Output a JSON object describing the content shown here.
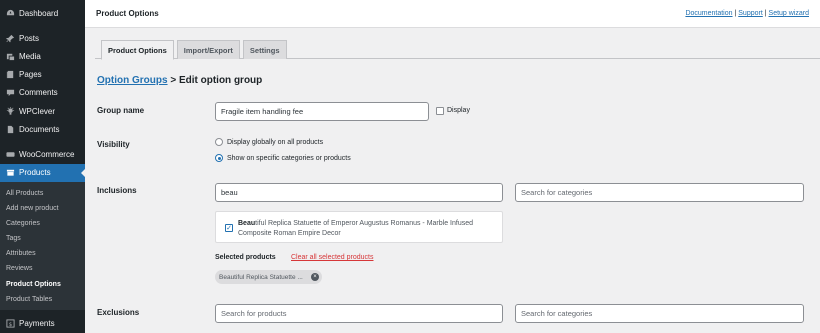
{
  "sidebar": {
    "items": [
      {
        "label": "Dashboard",
        "icon": "dashboard-icon"
      },
      {
        "label": "Posts",
        "icon": "pin-icon"
      },
      {
        "label": "Media",
        "icon": "media-icon"
      },
      {
        "label": "Pages",
        "icon": "pages-icon"
      },
      {
        "label": "Comments",
        "icon": "comment-icon"
      },
      {
        "label": "WPClever",
        "icon": "lightbulb-icon"
      },
      {
        "label": "Documents",
        "icon": "document-icon"
      },
      {
        "label": "WooCommerce",
        "icon": "woo-icon"
      },
      {
        "label": "Products",
        "icon": "archive-icon"
      }
    ],
    "submenu": [
      "All Products",
      "Add new product",
      "Categories",
      "Tags",
      "Attributes",
      "Reviews",
      "Product Options",
      "Product Tables"
    ],
    "payments": {
      "label": "Payments",
      "icon": "dollar-icon"
    }
  },
  "header": {
    "title": "Product Options",
    "links": [
      "Documentation",
      "Support",
      "Setup wizard"
    ],
    "separator": "|"
  },
  "tabs": [
    "Product Options",
    "Import/Export",
    "Settings"
  ],
  "breadcrumb": {
    "link": "Option Groups",
    "separator": ">",
    "current": "Edit option group"
  },
  "group_name": {
    "label": "Group name",
    "value": "Fragile item handling fee",
    "display_label": "Display"
  },
  "visibility": {
    "label": "Visibility",
    "options": [
      "Display globally on all products",
      "Show on specific categories or products"
    ],
    "selected": 1
  },
  "inclusions": {
    "label": "Inclusions",
    "product_search_value": "beau",
    "category_placeholder": "Search for categories",
    "result_match": "Beau",
    "result_rest": "tiful Replica Statuette of Emperor Augustus Romanus - Marble Infused Composite Roman Empire Decor",
    "selected_label": "Selected products",
    "clear_label": "Clear all selected products",
    "chip_label": "Beautiful Replica Statuette ...",
    "chip_remove": "×"
  },
  "exclusions": {
    "label": "Exclusions",
    "product_placeholder": "Search for products",
    "category_placeholder": "Search for categories"
  },
  "colors": {
    "accent": "#2271b1",
    "sidebar": "#1d2327",
    "danger": "#d63638"
  }
}
